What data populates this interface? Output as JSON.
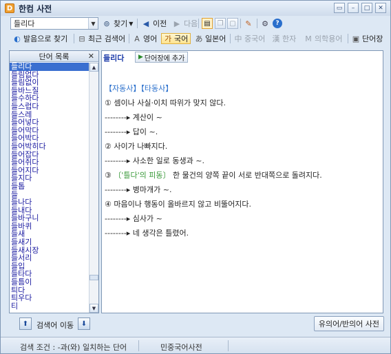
{
  "window": {
    "title": "한컴 사전",
    "app_icon": "D"
  },
  "search": {
    "value": "들리다"
  },
  "toolbar": {
    "find": "찾기",
    "prev": "이전",
    "next": "다음"
  },
  "modes": {
    "items": [
      {
        "label": "발음으로 찾기",
        "icon": "speaker-icon"
      },
      {
        "label": "최근 검색어",
        "icon": "history-icon"
      },
      {
        "label": "영어",
        "icon": "A"
      },
      {
        "label": "국어",
        "icon": "가",
        "active": true
      },
      {
        "label": "일본어",
        "icon": "あ"
      },
      {
        "label": "중국어",
        "icon": "中",
        "disabled": true
      },
      {
        "label": "한자",
        "icon": "漢",
        "disabled": true
      },
      {
        "label": "의학용어",
        "icon": "M",
        "disabled": true
      },
      {
        "label": "단어장",
        "icon": "book-icon"
      }
    ]
  },
  "wordlist": {
    "header": "단어 목록",
    "close": "✕",
    "items": [
      "들리다",
      "들림없다",
      "들림없이",
      "들바느질",
      "들수하다",
      "들스럽다",
      "들스레",
      "들어넣다",
      "들어막다",
      "들어박다",
      "들어박히다",
      "들어잡다",
      "들어쥐다",
      "들어지다",
      "들지다",
      "들톱",
      "들",
      "들나다",
      "들내다",
      "들바구니",
      "들바퀴",
      "들새",
      "들새기",
      "들새시장",
      "들서리",
      "들입",
      "들타다",
      "들틈이",
      "틔다",
      "틔우다",
      "티"
    ]
  },
  "entry": {
    "headword": "들리다",
    "add_label": "단어장에 추가",
    "pos": "【자동사】【타동사】",
    "lines": [
      {
        "type": "sense",
        "num": "①",
        "text": "셈이나 사실·이치 따위가 맞지 않다."
      },
      {
        "type": "ex",
        "text": "계산이 ~"
      },
      {
        "type": "ex",
        "text": "답이 ~."
      },
      {
        "type": "sense",
        "num": "②",
        "text": "사이가 나빠지다."
      },
      {
        "type": "ex",
        "text": "사소한 일로 동생과 ~."
      },
      {
        "type": "sense3",
        "num": "③",
        "hl": "〔'틀다'의 피동〕",
        "text": "한 물건의 양쪽 끝이 서로 반대쪽으로 돌려지다."
      },
      {
        "type": "ex",
        "text": "병마개가 ~."
      },
      {
        "type": "sense",
        "num": "④",
        "text": "마음이나 행동이 올바르지 않고 비뚤어지다."
      },
      {
        "type": "ex",
        "text": "심사가 ~"
      },
      {
        "type": "ex",
        "text": "네 생각은 틀렸어."
      }
    ]
  },
  "bottom": {
    "move": "검색어 이동",
    "syn": "유의어/반의어 사전"
  },
  "status": {
    "condition": "검색 조건 : -과(와) 일치하는 단어",
    "dict": "민중국어사전"
  },
  "colors": {
    "accent": "#3a6fd0",
    "pos": "#2a6fcc",
    "highlight": "#3a9a3a"
  }
}
